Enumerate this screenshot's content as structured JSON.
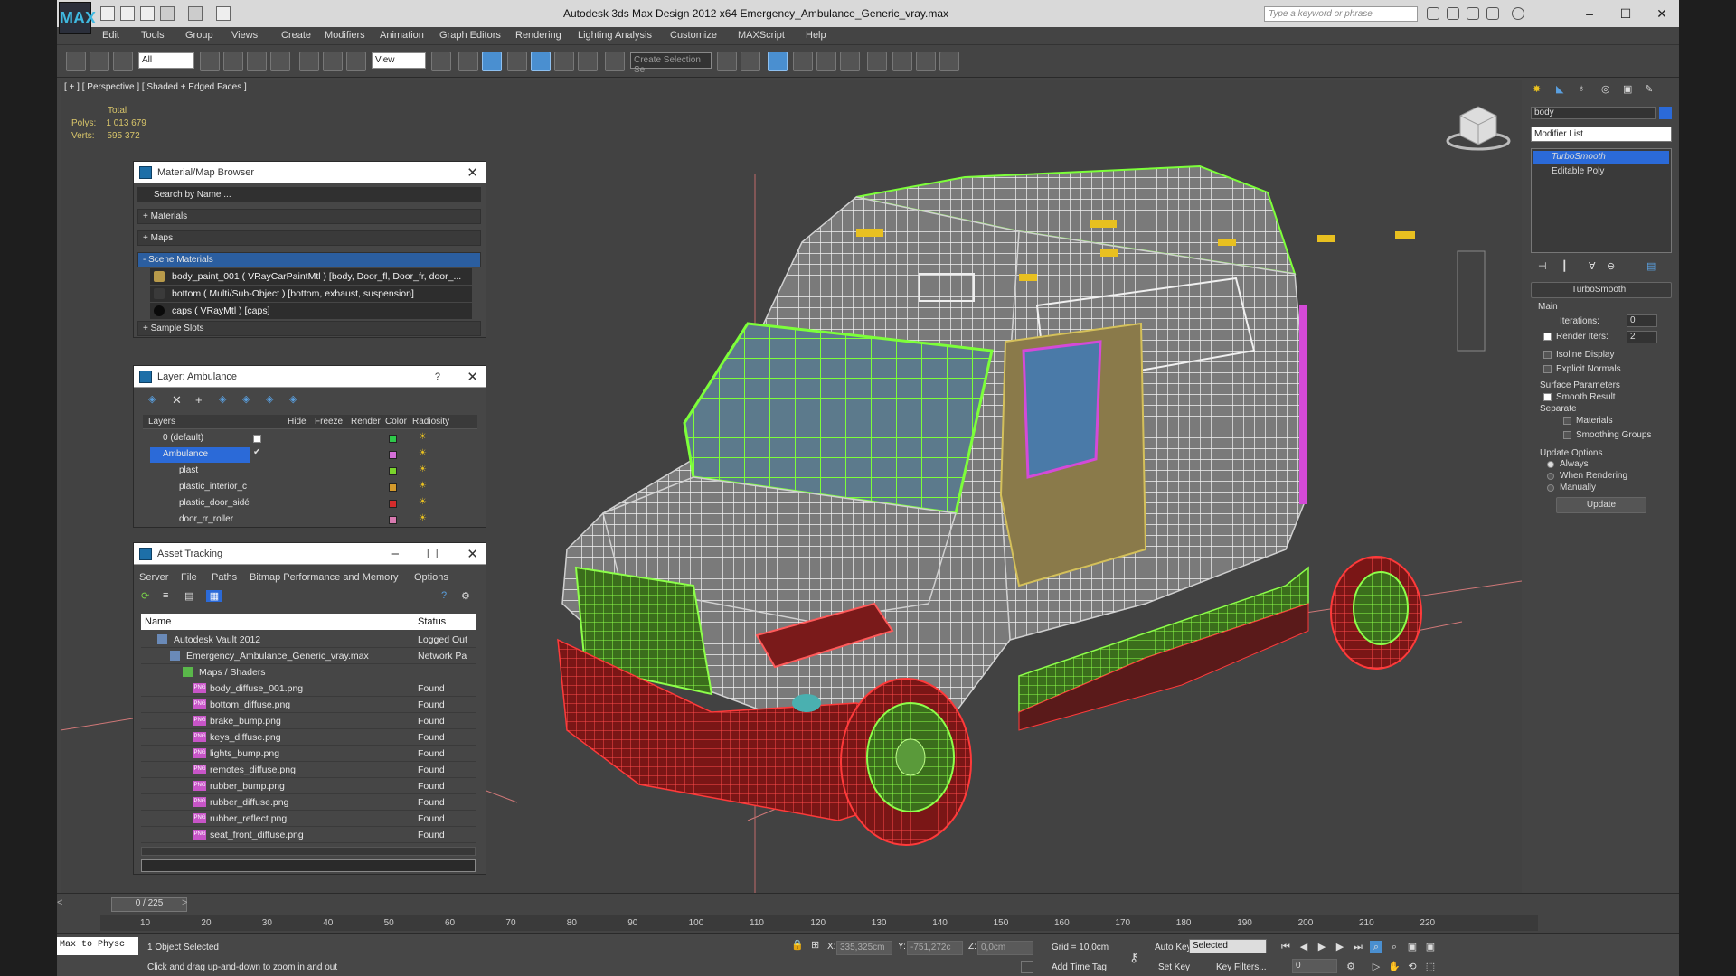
{
  "app": {
    "title": "Autodesk 3ds Max Design 2012 x64    Emergency_Ambulance_Generic_vray.max",
    "logo_text": "MAX",
    "search_placeholder": "Type a keyword or phrase"
  },
  "menu": [
    "Edit",
    "Tools",
    "Group",
    "Views",
    "Create",
    "Modifiers",
    "Animation",
    "Graph Editors",
    "Rendering",
    "Lighting Analysis",
    "Customize",
    "MAXScript",
    "Help"
  ],
  "toolbar": {
    "filter_value": "All",
    "refcoord_value": "View",
    "selection_set": "Create Selection Se"
  },
  "viewport": {
    "label": "[ + ] [ Perspective ] [ Shaded + Edged Faces ]",
    "stats": {
      "total_label": "Total",
      "polys_label": "Polys:",
      "polys_value": "1 013 679",
      "verts_label": "Verts:",
      "verts_value": "595 372"
    }
  },
  "material_browser": {
    "title": "Material/Map Browser",
    "search_placeholder": "Search by Name ...",
    "groups": [
      "+ Materials",
      "+ Maps",
      "- Scene Materials",
      "+ Sample Slots"
    ],
    "materials": [
      {
        "label": "body_paint_001  ( VRayCarPaintMtl ) [body, Door_fl, Door_fr, door_...",
        "color": "#b89a4a"
      },
      {
        "label": "bottom  ( Multi/Sub-Object ) [bottom, exhaust, suspension]",
        "color": "#3a3a3a"
      },
      {
        "label": "caps  ( VRayMtl ) [caps]",
        "color": "#0a0a0a"
      }
    ]
  },
  "layer_panel": {
    "title": "Layer: Ambulance",
    "help": "?",
    "columns": [
      "Layers",
      "Hide",
      "Freeze",
      "Render",
      "Color",
      "Radiosity"
    ],
    "rows": [
      {
        "name": "0 (default)",
        "color": "#2ec84a"
      },
      {
        "name": "Ambulance",
        "color": "#d46fd8",
        "selected": true
      },
      {
        "name": "plast",
        "color": "#7ad42c"
      },
      {
        "name": "plastic_interior_c",
        "color": "#d49a2c"
      },
      {
        "name": "plastic_door_sidé",
        "color": "#d42c2c"
      },
      {
        "name": "door_rr_roller",
        "color": "#d87ab0"
      }
    ]
  },
  "asset_tracking": {
    "title": "Asset Tracking",
    "menu": [
      "Server",
      "File",
      "Paths",
      "Bitmap Performance and Memory",
      "Options"
    ],
    "columns": [
      "Name",
      "Status"
    ],
    "rows": [
      {
        "name": "Autodesk Vault 2012",
        "status": "Logged Out",
        "indent": 0
      },
      {
        "name": "Emergency_Ambulance_Generic_vray.max",
        "status": "Network Pa",
        "indent": 1
      },
      {
        "name": "Maps / Shaders",
        "status": "",
        "indent": 2
      },
      {
        "name": "body_diffuse_001.png",
        "status": "Found",
        "indent": 3
      },
      {
        "name": "bottom_diffuse.png",
        "status": "Found",
        "indent": 3
      },
      {
        "name": "brake_bump.png",
        "status": "Found",
        "indent": 3
      },
      {
        "name": "keys_diffuse.png",
        "status": "Found",
        "indent": 3
      },
      {
        "name": "lights_bump.png",
        "status": "Found",
        "indent": 3
      },
      {
        "name": "remotes_diffuse.png",
        "status": "Found",
        "indent": 3
      },
      {
        "name": "rubber_bump.png",
        "status": "Found",
        "indent": 3
      },
      {
        "name": "rubber_diffuse.png",
        "status": "Found",
        "indent": 3
      },
      {
        "name": "rubber_reflect.png",
        "status": "Found",
        "indent": 3
      },
      {
        "name": "seat_front_diffuse.png",
        "status": "Found",
        "indent": 3
      }
    ],
    "png_badge": "PNG"
  },
  "command_panel": {
    "object_name": "body",
    "modifier_list": "Modifier List",
    "stack": [
      {
        "label": "TurboSmooth",
        "selected": true
      },
      {
        "label": "Editable Poly",
        "selected": false
      }
    ],
    "rollout_title": "TurboSmooth",
    "main_label": "Main",
    "iterations_label": "Iterations:",
    "iterations_value": "0",
    "render_iters_label": "Render Iters:",
    "render_iters_value": "2",
    "isoline": "Isoline Display",
    "explicit_normals": "Explicit Normals",
    "surface_params": "Surface Parameters",
    "smooth_result": "Smooth Result",
    "separate": "Separate",
    "materials": "Materials",
    "smoothing_groups": "Smoothing Groups",
    "update_options": "Update Options",
    "always": "Always",
    "when_rendering": "When Rendering",
    "manually": "Manually",
    "update_button": "Update"
  },
  "timeline": {
    "frame": "0 / 225",
    "ticks": [
      "10",
      "20",
      "30",
      "40",
      "50",
      "60",
      "70",
      "80",
      "90",
      "100",
      "110",
      "120",
      "130",
      "140",
      "150",
      "160",
      "170",
      "180",
      "190",
      "200",
      "210",
      "220"
    ]
  },
  "status": {
    "maxscript": "Max to Physc",
    "selected": "1 Object Selected",
    "hint": "Click and drag up-and-down to zoom in and out",
    "x_label": "X:",
    "x_value": "335,325cm",
    "y_label": "Y:",
    "y_value": "-751,272c",
    "z_label": "Z:",
    "z_value": "0,0cm",
    "grid": "Grid = 10,0cm",
    "add_time_tag": "Add Time Tag",
    "auto_key": "Auto Key",
    "set_key": "Set Key",
    "key_mode": "Selected",
    "key_filters": "Key Filters...",
    "frame_value": "0"
  }
}
